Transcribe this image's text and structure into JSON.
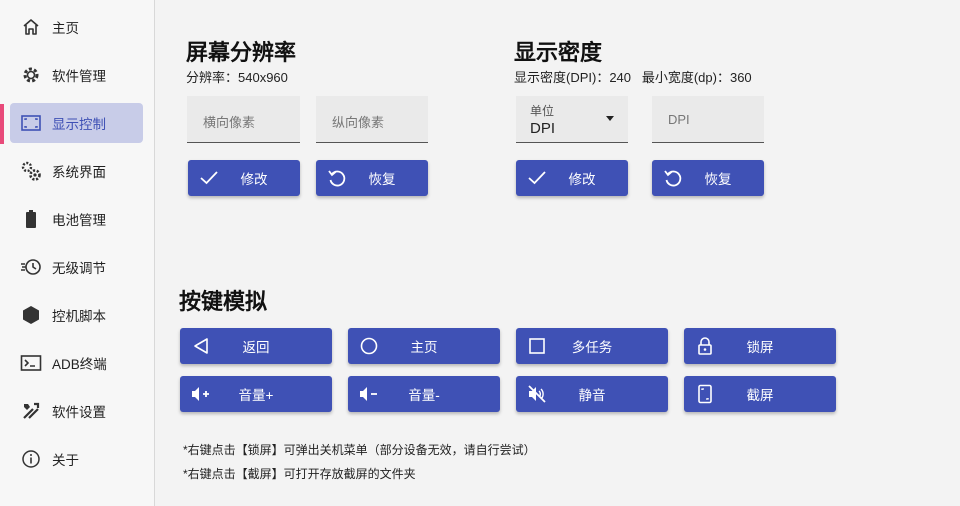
{
  "sidebar": {
    "items": [
      {
        "label": "主页",
        "icon": "home-icon"
      },
      {
        "label": "软件管理",
        "icon": "gear-icon"
      },
      {
        "label": "显示控制",
        "icon": "screen-icon",
        "active": true
      },
      {
        "label": "系统界面",
        "icon": "gears-icon"
      },
      {
        "label": "电池管理",
        "icon": "battery-icon"
      },
      {
        "label": "无级调节",
        "icon": "timer-icon"
      },
      {
        "label": "控机脚本",
        "icon": "hexagon-icon"
      },
      {
        "label": "ADB终端",
        "icon": "terminal-icon"
      },
      {
        "label": "软件设置",
        "icon": "tools-icon"
      },
      {
        "label": "关于",
        "icon": "info-icon"
      }
    ]
  },
  "resolution": {
    "title": "屏幕分辨率",
    "subtitle": "分辨率：540x960",
    "width_placeholder": "横向像素",
    "height_placeholder": "纵向像素",
    "apply_label": "修改",
    "reset_label": "恢复"
  },
  "density": {
    "title": "显示密度",
    "subtitle": "显示密度(DPI)：240   最小宽度(dp)：360",
    "unit_label": "单位",
    "unit_value": "DPI",
    "dpi_placeholder": "DPI",
    "apply_label": "修改",
    "reset_label": "恢复"
  },
  "keys": {
    "title": "按键模拟",
    "buttons": [
      {
        "label": "返回",
        "icon": "back-triangle-icon"
      },
      {
        "label": "主页",
        "icon": "home-circle-icon"
      },
      {
        "label": "多任务",
        "icon": "recents-square-icon"
      },
      {
        "label": "锁屏",
        "icon": "lock-icon"
      },
      {
        "label": "音量+",
        "icon": "volume-up-icon"
      },
      {
        "label": "音量-",
        "icon": "volume-down-icon"
      },
      {
        "label": "静音",
        "icon": "mute-icon"
      },
      {
        "label": "截屏",
        "icon": "screenshot-icon"
      }
    ],
    "notes": [
      "*右键点击【锁屏】可弹出关机菜单（部分设备无效，请自行尝试）",
      "*右键点击【截屏】可打开存放截屏的文件夹"
    ]
  },
  "colors": {
    "accent": "#3f51b5",
    "active_bg": "#c8cce8",
    "indicator": "#e84a7a"
  }
}
